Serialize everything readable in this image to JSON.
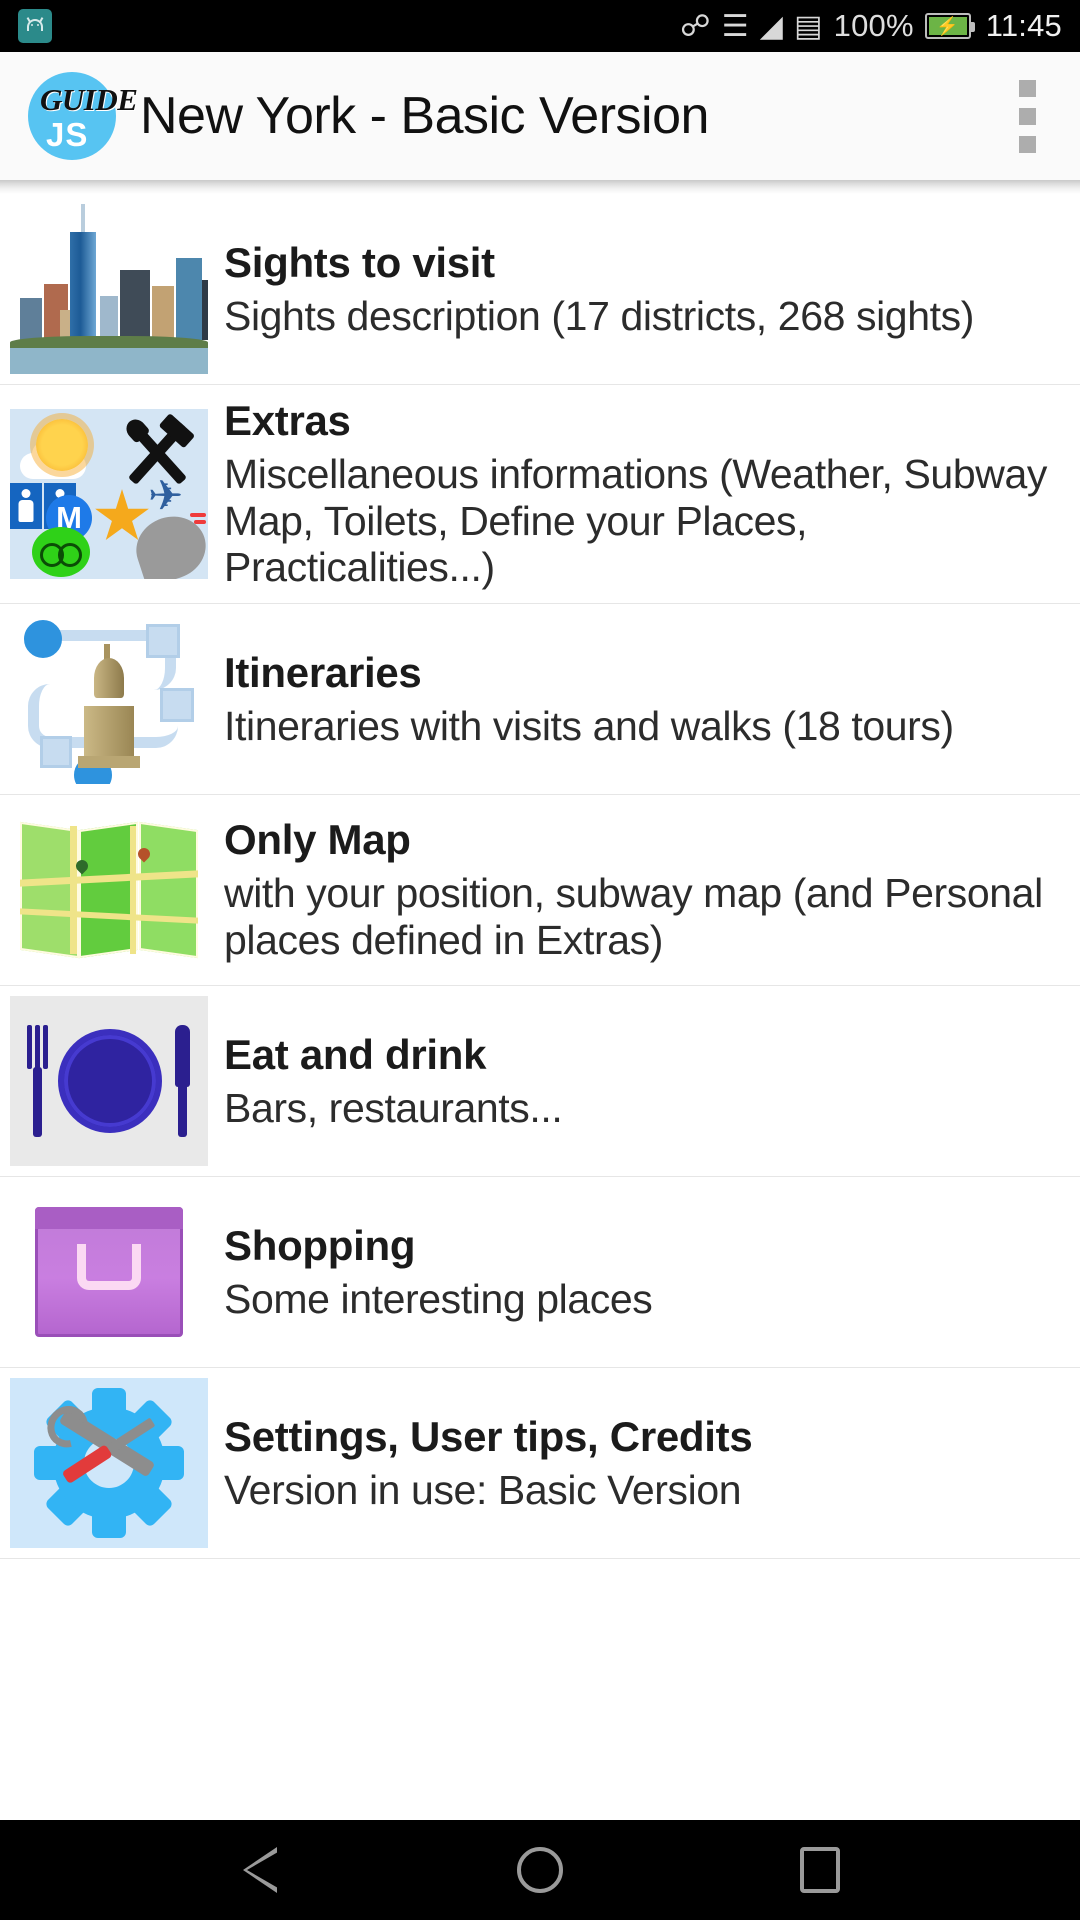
{
  "status_bar": {
    "notification_icon": "android-notification-icon",
    "icons": [
      "bluetooth-icon",
      "vibrate-icon",
      "wifi-icon",
      "sim-card-icon"
    ],
    "battery_percent": "100%",
    "battery_icon": "battery-charging-icon",
    "clock": "11:45"
  },
  "app_bar": {
    "logo_top": "GUIDE",
    "logo_bottom": "JS",
    "title": "New York - Basic Version",
    "overflow_menu": "overflow-menu-icon"
  },
  "list": {
    "items": [
      {
        "icon": "nyc-skyline-thumbnail",
        "title": "Sights to visit",
        "subtitle": "Sights description (17 districts, 268 sights)"
      },
      {
        "icon": "extras-collage-thumbnail",
        "title": "Extras",
        "subtitle": "Miscellaneous informations (Weather, Subway Map, Toilets, Define your Places, Practicalities...)"
      },
      {
        "icon": "itinerary-route-thumbnail",
        "title": "Itineraries",
        "subtitle": "Itineraries with visits and walks (18 tours)"
      },
      {
        "icon": "folded-map-thumbnail",
        "title": "Only Map",
        "subtitle": "with your position, subway map (and Personal places defined in Extras)"
      },
      {
        "icon": "plate-cutlery-thumbnail",
        "title": "Eat and drink",
        "subtitle": "Bars, restaurants..."
      },
      {
        "icon": "shopping-bag-thumbnail",
        "title": "Shopping",
        "subtitle": "Some interesting places"
      },
      {
        "icon": "settings-gear-tools-thumbnail",
        "title": "Settings, User tips, Credits",
        "subtitle": "Version in use: Basic Version"
      }
    ]
  },
  "nav_bar": {
    "back": "back-triangle-icon",
    "home": "home-circle-icon",
    "recents": "recents-square-icon"
  },
  "colors": {
    "logo_blue": "#57c4f2",
    "app_bar_bg": "#fafafa",
    "nav_bg": "#000000",
    "battery_green": "#6cb446"
  }
}
